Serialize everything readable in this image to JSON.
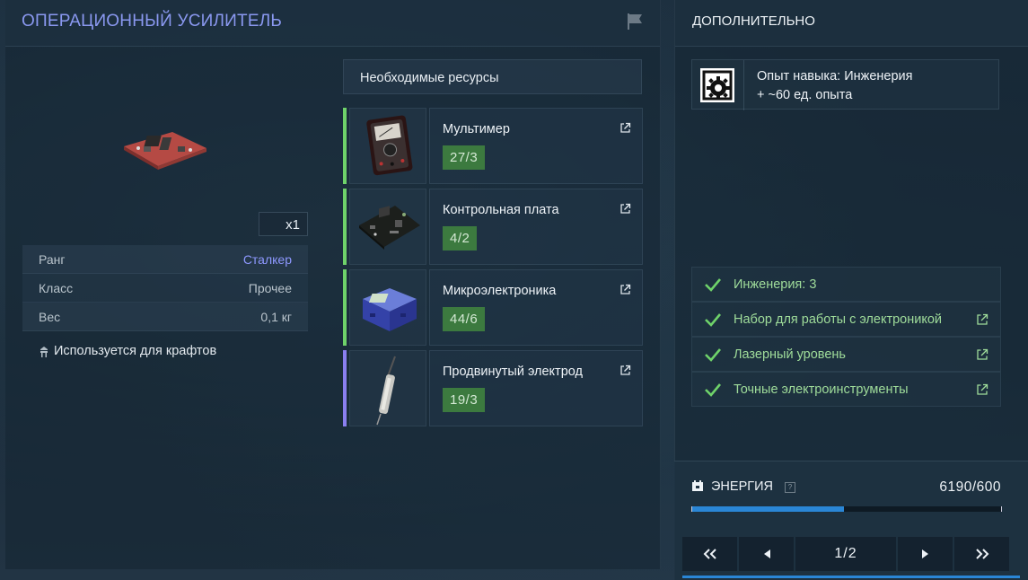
{
  "item": {
    "title": "ОПЕРАЦИОННЫЙ УСИЛИТЕЛЬ",
    "quantity": "x1",
    "stats": [
      {
        "label": "Ранг",
        "value": "Сталкер"
      },
      {
        "label": "Класс",
        "value": "Прочее"
      },
      {
        "label": "Вес",
        "value": "0,1 кг"
      }
    ],
    "crafts_note": "Используется для крафтов"
  },
  "resources": {
    "header": "Необходимые ресурсы",
    "items": [
      {
        "name": "Мультимер",
        "count": "27/3",
        "bar_color": "#6fd36a"
      },
      {
        "name": "Контрольная плата",
        "count": "4/2",
        "bar_color": "#6fd36a"
      },
      {
        "name": "Микроэлектроника",
        "count": "44/6",
        "bar_color": "#6fd36a"
      },
      {
        "name": "Продвинутый электрод",
        "count": "19/3",
        "bar_color": "#8a7ff0"
      }
    ]
  },
  "extra": {
    "title": "ДОПОЛНИТЕЛЬНО",
    "skill_line1": "Опыт навыка: Инженерия",
    "skill_line2": "+ ~60 ед. опыта",
    "requirements": [
      {
        "label": "Инженерия: 3",
        "has_link": false
      },
      {
        "label": "Набор для работы с электроникой",
        "has_link": true
      },
      {
        "label": "Лазерный уровень",
        "has_link": true
      },
      {
        "label": "Точные электроинструменты",
        "has_link": true
      }
    ]
  },
  "energy": {
    "label": "ЭНЕРГИЯ",
    "help": "?",
    "value": "6190/600",
    "fill_fraction": 0.49
  },
  "pager": {
    "page": "1/2"
  },
  "colors": {
    "accent": "#8a98f0",
    "count_bg": "#3c7a3f",
    "check": "#6fd36a",
    "energy": "#2a86d6"
  }
}
